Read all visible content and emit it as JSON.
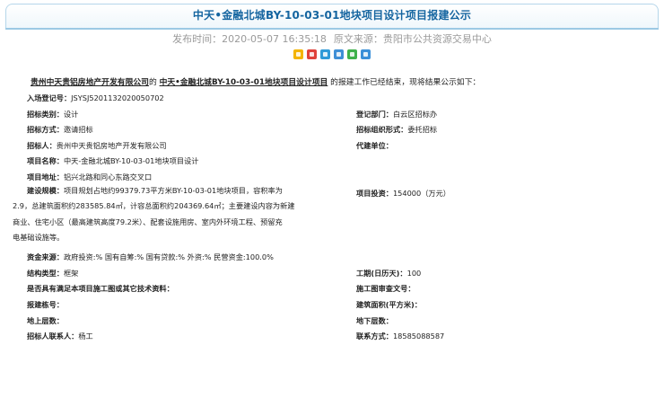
{
  "header": {
    "title": "中天•金融北城BY-10-03-01地块项目设计项目报建公示",
    "publish_label": "发布时间：",
    "publish_time": "2020-05-07 16:35:18",
    "source_label": "原文来源：",
    "source": "贵阳市公共资源交易中心"
  },
  "share_icons": [
    {
      "name": "favorite-icon",
      "color": "#f4b400"
    },
    {
      "name": "weibo-icon",
      "color": "#e0413a"
    },
    {
      "name": "qzone-icon",
      "color": "#2f9ad8"
    },
    {
      "name": "tencent-icon",
      "color": "#3f8fd6"
    },
    {
      "name": "wechat-icon",
      "color": "#3fb14a"
    },
    {
      "name": "more-share-icon",
      "color": "#3a8fd8"
    }
  ],
  "intro": {
    "company": "贵州中天贵铝房地产开发有限公司",
    "mid": "的",
    "project": "中天•金融北城BY-10-03-01地块项目设计项目",
    "tail": "的报建工作已经结束，现将结果公示如下："
  },
  "fields": {
    "reg_no": {
      "label": "入场登记号：",
      "value": "JSYSJ5201132020050702"
    },
    "bid_type": {
      "label": "招标类别：",
      "value": "设计"
    },
    "reg_dept": {
      "label": "登记部门：",
      "value": "白云区招标办"
    },
    "bid_method": {
      "label": "招标方式：",
      "value": "邀请招标"
    },
    "bid_org_form": {
      "label": "招标组织形式：",
      "value": "委托招标"
    },
    "tenderer": {
      "label": "招标人：",
      "value": "贵州中天贵铝房地产开发有限公司"
    },
    "agency": {
      "label": "代建单位：",
      "value": ""
    },
    "project_name": {
      "label": "项目名称：",
      "value": "中天-金融北城BY-10-03-01地块项目设计"
    },
    "project_address": {
      "label": "项目地址：",
      "value": "铝兴北路和同心东路交叉口"
    },
    "scale": {
      "label": "建设规模：",
      "line1": "项目规划占地约99379.73平方米BY-10-03-01地块项目，容积率为",
      "line2": "2.9，总建筑面积约283585.84㎡，计容总面积约204369.64㎡；主要建设内容为新建",
      "line3": "商业、住宅小区（最高建筑高度79.2米）、配套设施用房、室内外环境工程、预留充",
      "line4": "电基础设施等。"
    },
    "investment": {
      "label": "项目投资：",
      "value": "154000（万元）"
    },
    "fund_source": {
      "label": "资金来源：",
      "value": "政府投资:% 国有自筹:% 国有贷款:% 外资:% 民营资金:100.0%"
    },
    "structure": {
      "label": "结构类型：",
      "value": "框架"
    },
    "duration": {
      "label": "工期(日历天)：",
      "value": "100"
    },
    "drawings": {
      "label": "是否具有满足本项目施工图或其它技术资料：",
      "value": ""
    },
    "review_no": {
      "label": "施工图审查文号：",
      "value": ""
    },
    "building_no": {
      "label": "报建栋号：",
      "value": ""
    },
    "area": {
      "label": "建筑面积(平方米)：",
      "value": ""
    },
    "above_floors": {
      "label": "地上层数：",
      "value": ""
    },
    "below_floors": {
      "label": "地下层数：",
      "value": ""
    },
    "contact": {
      "label": "招标人联系人：",
      "value": "杨工"
    },
    "phone": {
      "label": "联系方式：",
      "value": "18585088587"
    }
  }
}
